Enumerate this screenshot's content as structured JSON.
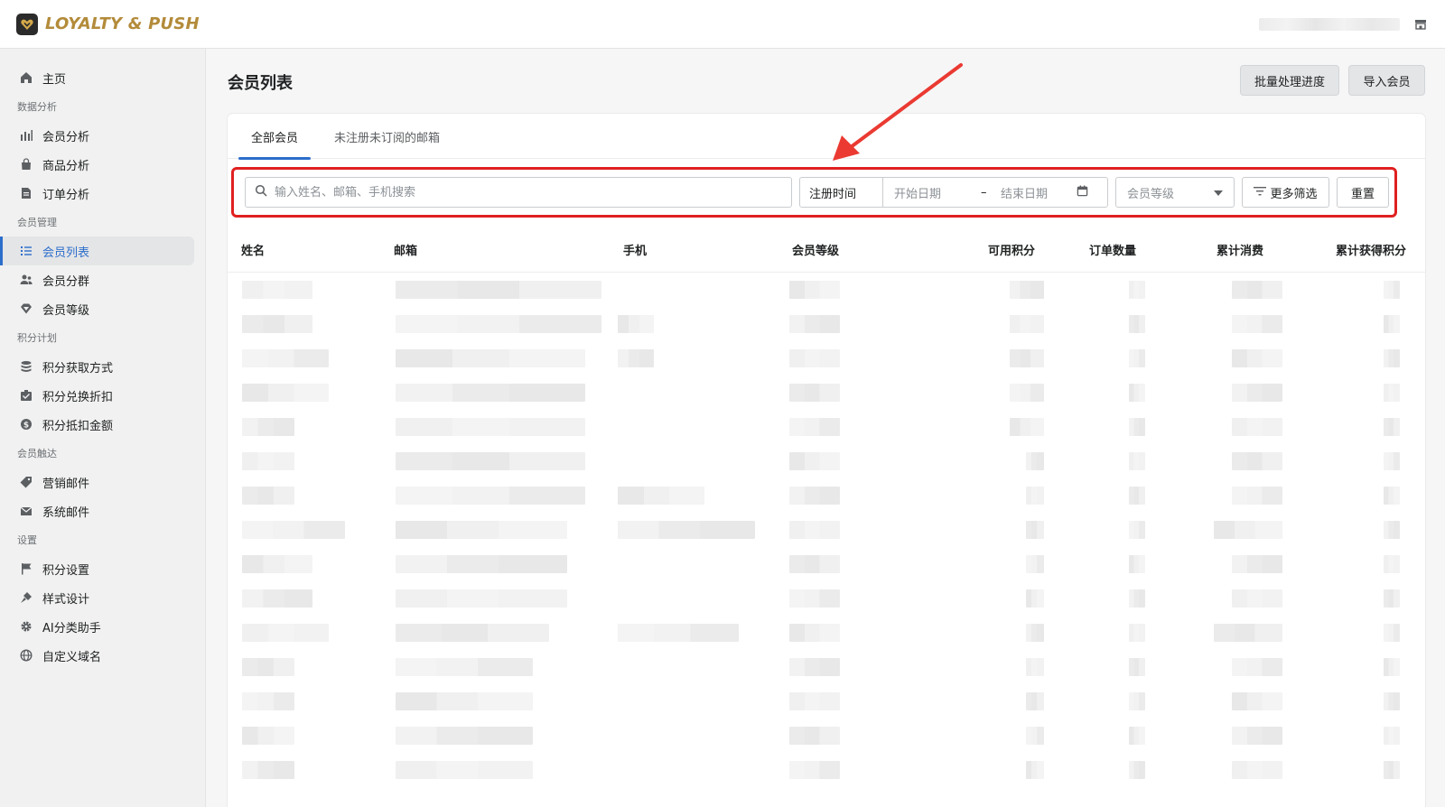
{
  "app": {
    "logo_text": "LOYALTY & PUSH",
    "accent_color": "#2c6ecb",
    "logo_color": "#b38b3a"
  },
  "sidebar": {
    "home": "主页",
    "sections": [
      {
        "title": "数据分析",
        "items": [
          {
            "label": "会员分析",
            "icon": "bar-chart-icon"
          },
          {
            "label": "商品分析",
            "icon": "shopping-bag-icon"
          },
          {
            "label": "订单分析",
            "icon": "document-icon"
          }
        ]
      },
      {
        "title": "会员管理",
        "items": [
          {
            "label": "会员列表",
            "icon": "list-icon",
            "active": true
          },
          {
            "label": "会员分群",
            "icon": "users-icon"
          },
          {
            "label": "会员等级",
            "icon": "diamond-icon"
          }
        ]
      },
      {
        "title": "积分计划",
        "items": [
          {
            "label": "积分获取方式",
            "icon": "database-icon"
          },
          {
            "label": "积分兑换折扣",
            "icon": "discount-envelope-icon"
          },
          {
            "label": "积分抵扣金额",
            "icon": "dollar-icon"
          }
        ]
      },
      {
        "title": "会员触达",
        "items": [
          {
            "label": "营销邮件",
            "icon": "tag-icon"
          },
          {
            "label": "系统邮件",
            "icon": "mail-icon"
          }
        ]
      },
      {
        "title": "设置",
        "items": [
          {
            "label": "积分设置",
            "icon": "flag-icon"
          },
          {
            "label": "样式设计",
            "icon": "paint-icon"
          },
          {
            "label": "AI分类助手",
            "icon": "gear-icon"
          },
          {
            "label": "自定义域名",
            "icon": "globe-icon"
          }
        ]
      }
    ]
  },
  "main": {
    "title": "会员列表",
    "batch_progress_label": "批量处理进度",
    "import_label": "导入会员",
    "tabs": [
      {
        "label": "全部会员",
        "active": true
      },
      {
        "label": "未注册未订阅的邮箱",
        "active": false
      }
    ],
    "filters": {
      "search_placeholder": "输入姓名、邮箱、手机搜索",
      "date_label": "注册时间",
      "start_date": "开始日期",
      "date_sep": "–",
      "end_date": "结束日期",
      "level_placeholder": "会员等级",
      "more_filters": "更多筛选",
      "reset": "重置"
    },
    "table": {
      "columns": [
        "姓名",
        "邮箱",
        "手机",
        "会员等级",
        "可用积分",
        "订单数量",
        "累计消费",
        "累计获得积分"
      ]
    }
  }
}
